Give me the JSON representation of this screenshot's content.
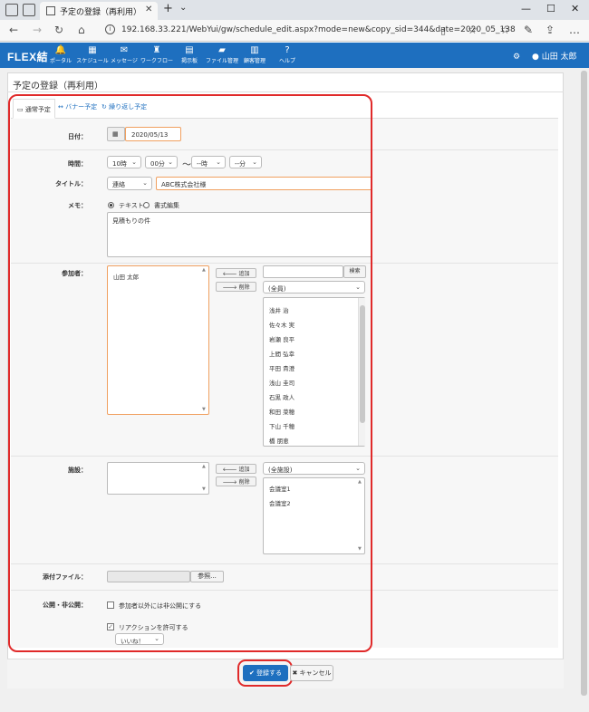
{
  "browser": {
    "tab_title": "予定の登録（再利用）",
    "url": "192.168.33.221/WebYui/gw/schedule_edit.aspx?mode=new&copy_sid=344&date=2020_05_138"
  },
  "app": {
    "logo": "FLEX結",
    "nav": [
      {
        "icon": "bell-icon",
        "glyph": "🔔",
        "label": "ポータル"
      },
      {
        "icon": "calendar-icon",
        "glyph": "▦",
        "label": "スケジュール"
      },
      {
        "icon": "mail-icon",
        "glyph": "✉",
        "label": "メッセージ"
      },
      {
        "icon": "stamp-icon",
        "glyph": "♜",
        "label": "ワークフロー"
      },
      {
        "icon": "board-icon",
        "glyph": "▤",
        "label": "掲示板"
      },
      {
        "icon": "folder-icon",
        "glyph": "▰",
        "label": "ファイル管理"
      },
      {
        "icon": "book-icon",
        "glyph": "▥",
        "label": "顧客管理"
      },
      {
        "icon": "help-icon",
        "glyph": "?",
        "label": "ヘルプ"
      }
    ],
    "user_name": "山田 太郎"
  },
  "page": {
    "title": "予定の登録（再利用）",
    "tabs": [
      "通常予定",
      "バナー予定",
      "繰り返し予定"
    ]
  },
  "form": {
    "date_label": "日付：",
    "date_value": "2020/05/13",
    "time_label": "時間：",
    "start_hour": "10時",
    "start_min": "00分",
    "tilde": "〜",
    "end_hour": "--時",
    "end_min": "--分",
    "title_label": "タイトル：",
    "title_category": "連絡",
    "title_value": "ABC株式会社様",
    "memo_label": "メモ：",
    "memo_mode_text": "テキスト",
    "memo_mode_rich": "書式編集",
    "memo_value": "見積もりの件",
    "participants_label": "参加者：",
    "participants_selected": [
      "山田 太郎"
    ],
    "add_label": "追加",
    "remove_label": "削除",
    "search_button": "検索",
    "group_select": "(全員)",
    "candidates": [
      "浅井 治",
      "佐々木 実",
      "岩瀬 良平",
      "上間 弘幸",
      "平田 貴澄",
      "浅山 圭司",
      "石黒 政人",
      "和田 菜穂",
      "下山 千穂",
      "橋 朋恵"
    ],
    "facility_label": "施設：",
    "facility_group": "(全施設)",
    "facilities": [
      "会議室1",
      "会議室2"
    ],
    "attachment_label": "添付ファイル：",
    "browse_button": "参照...",
    "visibility_label": "公開・非公開：",
    "private_checkbox": "参加者以外には非公開にする",
    "reaction_checkbox": "リアクションを許可する",
    "reaction_select": "いいね！"
  },
  "footer": {
    "save_button": "登録する",
    "cancel_button": "キャンセル"
  }
}
